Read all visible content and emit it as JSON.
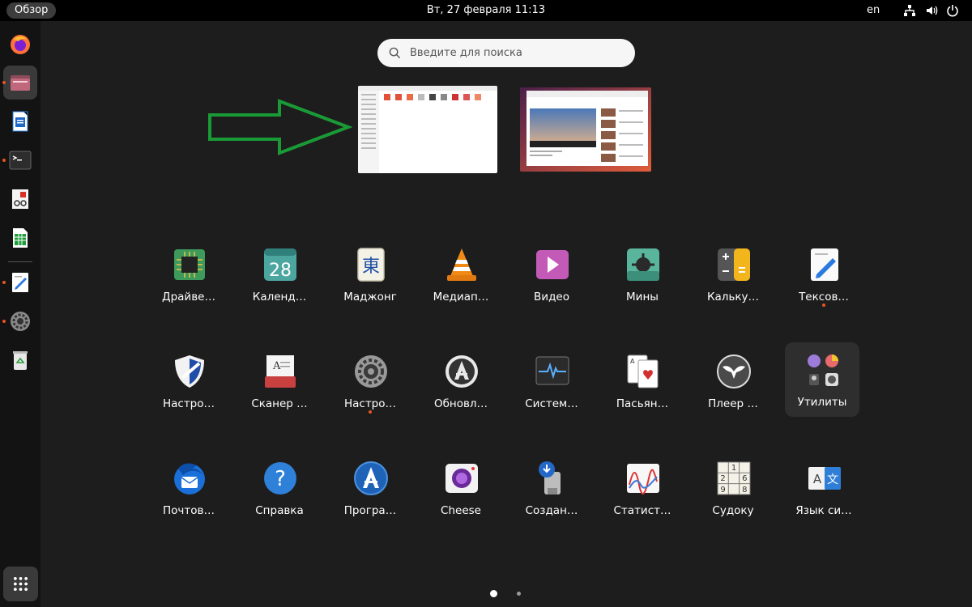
{
  "topbar": {
    "activities": "Обзор",
    "clock": "Вт, 27 февраля  11:13",
    "language": "en",
    "tray_icons": [
      "network-icon",
      "volume-icon",
      "power-icon"
    ]
  },
  "dock": {
    "items": [
      {
        "name": "firefox",
        "icon": "firefox-icon",
        "running": false,
        "active": false
      },
      {
        "name": "files",
        "icon": "folder-icon",
        "running": true,
        "active": true
      },
      {
        "name": "writer",
        "icon": "writer-icon",
        "running": false,
        "active": false
      },
      {
        "name": "terminal",
        "icon": "terminal-icon",
        "running": true,
        "active": false
      },
      {
        "name": "document-viewer",
        "icon": "document-viewer-icon",
        "running": false,
        "active": false
      },
      {
        "name": "calc",
        "icon": "spreadsheet-icon",
        "running": false,
        "active": false
      },
      {
        "name": "text-editor",
        "icon": "text-editor-icon",
        "running": true,
        "active": false
      },
      {
        "name": "settings",
        "icon": "settings-icon",
        "running": true,
        "active": false
      },
      {
        "name": "trash",
        "icon": "trash-icon",
        "running": false,
        "active": false
      }
    ],
    "show_apps": "grid-icon"
  },
  "search": {
    "placeholder": "Введите для поиска"
  },
  "apps": [
    {
      "label": "Драйве…",
      "icon": "chip-icon",
      "running": false
    },
    {
      "label": "Календ…",
      "icon": "calendar-icon",
      "day": "28",
      "running": false
    },
    {
      "label": "Маджонг",
      "icon": "mahjong-icon",
      "glyph": "東",
      "running": false
    },
    {
      "label": "Медиап…",
      "icon": "vlc-icon",
      "running": false
    },
    {
      "label": "Видео",
      "icon": "video-icon",
      "running": false
    },
    {
      "label": "Мины",
      "icon": "mines-icon",
      "running": false
    },
    {
      "label": "Кальку…",
      "icon": "calculator-icon",
      "running": false
    },
    {
      "label": "Тексов…",
      "icon": "text-editor-icon",
      "running": true
    },
    {
      "label": "Настро…",
      "icon": "shield-icon",
      "running": false
    },
    {
      "label": "Сканер …",
      "icon": "scanner-icon",
      "running": false
    },
    {
      "label": "Настро…",
      "icon": "settings-icon",
      "running": true
    },
    {
      "label": "Обновл…",
      "icon": "updater-icon",
      "running": false
    },
    {
      "label": "Систем…",
      "icon": "system-monitor-icon",
      "running": false
    },
    {
      "label": "Пасьян…",
      "icon": "cards-icon",
      "running": false
    },
    {
      "label": "Плеер …",
      "icon": "rhythmbox-icon",
      "running": false
    },
    {
      "label": "Утилиты",
      "icon": "utilities-folder-icon",
      "running": false,
      "folder": true
    },
    {
      "label": "Почтов…",
      "icon": "thunderbird-icon",
      "running": false
    },
    {
      "label": "Справка",
      "icon": "help-icon",
      "glyph": "?",
      "running": false
    },
    {
      "label": "Програ…",
      "icon": "app-center-icon",
      "running": false
    },
    {
      "label": "Cheese",
      "icon": "cheese-icon",
      "running": false
    },
    {
      "label": "Создан…",
      "icon": "usb-creator-icon",
      "running": false
    },
    {
      "label": "Статист…",
      "icon": "statistics-icon",
      "running": false
    },
    {
      "label": "Судоку",
      "icon": "sudoku-icon",
      "sudoku": [
        "1",
        "2",
        "6",
        "9",
        "8"
      ],
      "running": false
    },
    {
      "label": "Язык си…",
      "icon": "language-icon",
      "glyphs": [
        "A",
        "文"
      ],
      "running": false
    }
  ],
  "pages": {
    "count": 2,
    "current": 1
  },
  "colors": {
    "accent": "#e95420",
    "arrow": "#1a9a36",
    "background": "#1d1d1d"
  }
}
